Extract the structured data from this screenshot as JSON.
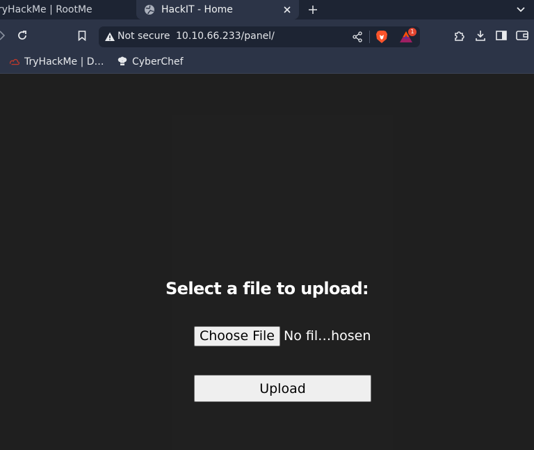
{
  "tabs": {
    "inactive": {
      "title": "ryHackMe | RootMe"
    },
    "active": {
      "title": "HackIT - Home"
    }
  },
  "toolbar": {
    "security_label": "Not secure",
    "url": "10.10.66.233/panel/",
    "rewards_badge": "1"
  },
  "bookmarks": [
    {
      "label": "TryHackMe | D…",
      "icon": "tryhackme-icon"
    },
    {
      "label": "CyberChef",
      "icon": "cyberchef-icon"
    }
  ],
  "page": {
    "heading": "Select a file to upload:",
    "choose_file_label": "Choose File",
    "no_file_text": "No fil…hosen",
    "upload_label": "Upload"
  },
  "colors": {
    "tabstrip": "#1d2433",
    "toolbar": "#2c3447",
    "page_bg": "#1f1f1f",
    "button_bg": "#efefef",
    "brave_orange": "#fb542b"
  }
}
